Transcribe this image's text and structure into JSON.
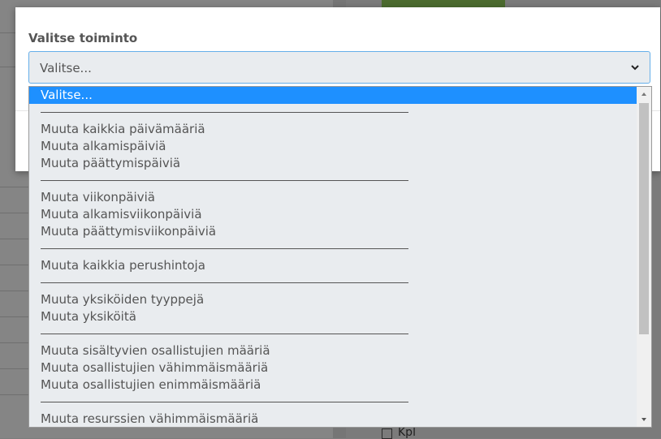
{
  "modal": {
    "title": "Valitse toiminto",
    "select": {
      "current_value": "Valitse...",
      "chevron_icon": "chevron-down-icon"
    }
  },
  "dropdown": {
    "options": [
      {
        "label": "Valitse...",
        "selected": true
      },
      {
        "separator": true
      },
      {
        "label": "Muuta kaikkia päivämääriä"
      },
      {
        "label": "Muuta alkamispäiviä"
      },
      {
        "label": "Muuta päättymispäiviä"
      },
      {
        "separator": true
      },
      {
        "label": "Muuta viikonpäiviä"
      },
      {
        "label": "Muuta alkamisviikonpäiviä"
      },
      {
        "label": "Muuta päättymisviikonpäiviä"
      },
      {
        "separator": true
      },
      {
        "label": "Muuta kaikkia perushintoja"
      },
      {
        "separator": true
      },
      {
        "label": "Muuta yksiköiden tyyppejä"
      },
      {
        "label": "Muuta yksiköitä"
      },
      {
        "separator": true
      },
      {
        "label": "Muuta sisältyvien osallistujien määriä"
      },
      {
        "label": "Muuta osallistujien vähimmäismääriä"
      },
      {
        "label": "Muuta osallistujien enimmäismääriä"
      },
      {
        "separator": true
      },
      {
        "label": "Muuta resurssien vähimmäismääriä"
      }
    ]
  },
  "background": {
    "kpl_label": "Kpl"
  },
  "colors": {
    "selected_option": "#1e90ff",
    "focus_border": "#66afe9"
  }
}
